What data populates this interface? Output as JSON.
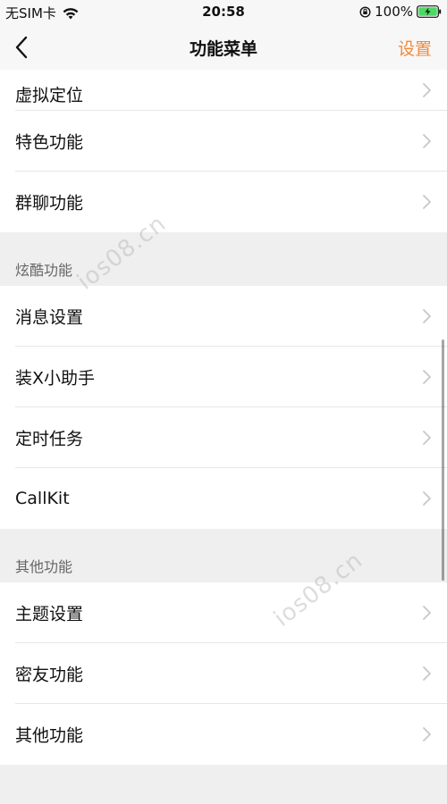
{
  "status_bar": {
    "carrier": "无SIM卡",
    "time": "20:58",
    "battery": "100%",
    "icons": [
      "wifi-icon",
      "orientation-lock-icon",
      "battery-charging-icon"
    ]
  },
  "nav": {
    "back_icon": "chevron-left-icon",
    "title": "功能菜单",
    "action": "设置",
    "action_color": "#f08a3c"
  },
  "groups": [
    {
      "title": "",
      "items": [
        {
          "label": "虚拟定位"
        },
        {
          "label": "特色功能"
        },
        {
          "label": "群聊功能"
        }
      ]
    },
    {
      "title": "炫酷功能",
      "items": [
        {
          "label": "消息设置"
        },
        {
          "label": "装X小助手"
        },
        {
          "label": "定时任务"
        },
        {
          "label": "CallKit"
        }
      ]
    },
    {
      "title": "其他功能",
      "items": [
        {
          "label": "主题设置"
        },
        {
          "label": "密友功能"
        },
        {
          "label": "其他功能"
        }
      ]
    }
  ],
  "watermark": "ios08.cn",
  "colors": {
    "background": "#efefef",
    "row": "#ffffff",
    "accent": "#f08a3c"
  }
}
